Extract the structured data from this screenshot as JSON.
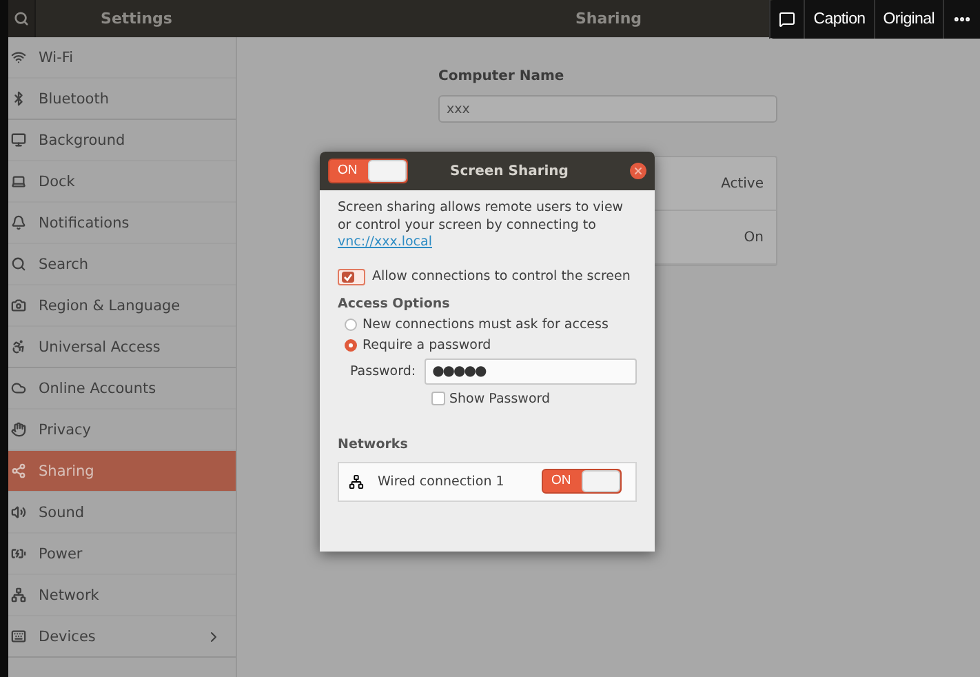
{
  "header": {
    "sidebar_title": "Settings",
    "page_title": "Sharing"
  },
  "viewer_bar": {
    "buttons": [
      "Caption",
      "Original"
    ]
  },
  "sidebar": {
    "items": [
      {
        "label": "Wi-Fi",
        "selected": false
      },
      {
        "label": "Bluetooth",
        "selected": false
      },
      {
        "label": "Background",
        "selected": false
      },
      {
        "label": "Dock",
        "selected": false
      },
      {
        "label": "Notifications",
        "selected": false
      },
      {
        "label": "Search",
        "selected": false
      },
      {
        "label": "Region & Language",
        "selected": false
      },
      {
        "label": "Universal Access",
        "selected": false
      },
      {
        "label": "Online Accounts",
        "selected": false
      },
      {
        "label": "Privacy",
        "selected": false
      },
      {
        "label": "Sharing",
        "selected": true
      },
      {
        "label": "Sound",
        "selected": false
      },
      {
        "label": "Power",
        "selected": false
      },
      {
        "label": "Network",
        "selected": false
      },
      {
        "label": "Devices",
        "selected": false,
        "expandable": true
      }
    ]
  },
  "computer_name": {
    "label": "Computer Name",
    "value": "xxx"
  },
  "services": [
    {
      "status": "Active"
    },
    {
      "status": "On"
    }
  ],
  "dialog": {
    "title": "Screen Sharing",
    "toggle": {
      "label": "ON",
      "on": true
    },
    "description": "Screen sharing allows remote users to view or control your screen by connecting to ",
    "link": "vnc://xxx.local",
    "allow_control": {
      "label": "Allow connections to control the screen",
      "checked": true
    },
    "access_heading": "Access Options",
    "access_options": [
      {
        "label": "New connections must ask for access",
        "selected": false
      },
      {
        "label": "Require a password",
        "selected": true
      }
    ],
    "password": {
      "label": "Password:",
      "value": "●●●●●"
    },
    "show_password": {
      "label": "Show Password",
      "checked": false
    },
    "networks_heading": "Networks",
    "networks": [
      {
        "name": "Wired connection 1",
        "toggle": {
          "label": "ON",
          "on": true
        }
      }
    ]
  }
}
